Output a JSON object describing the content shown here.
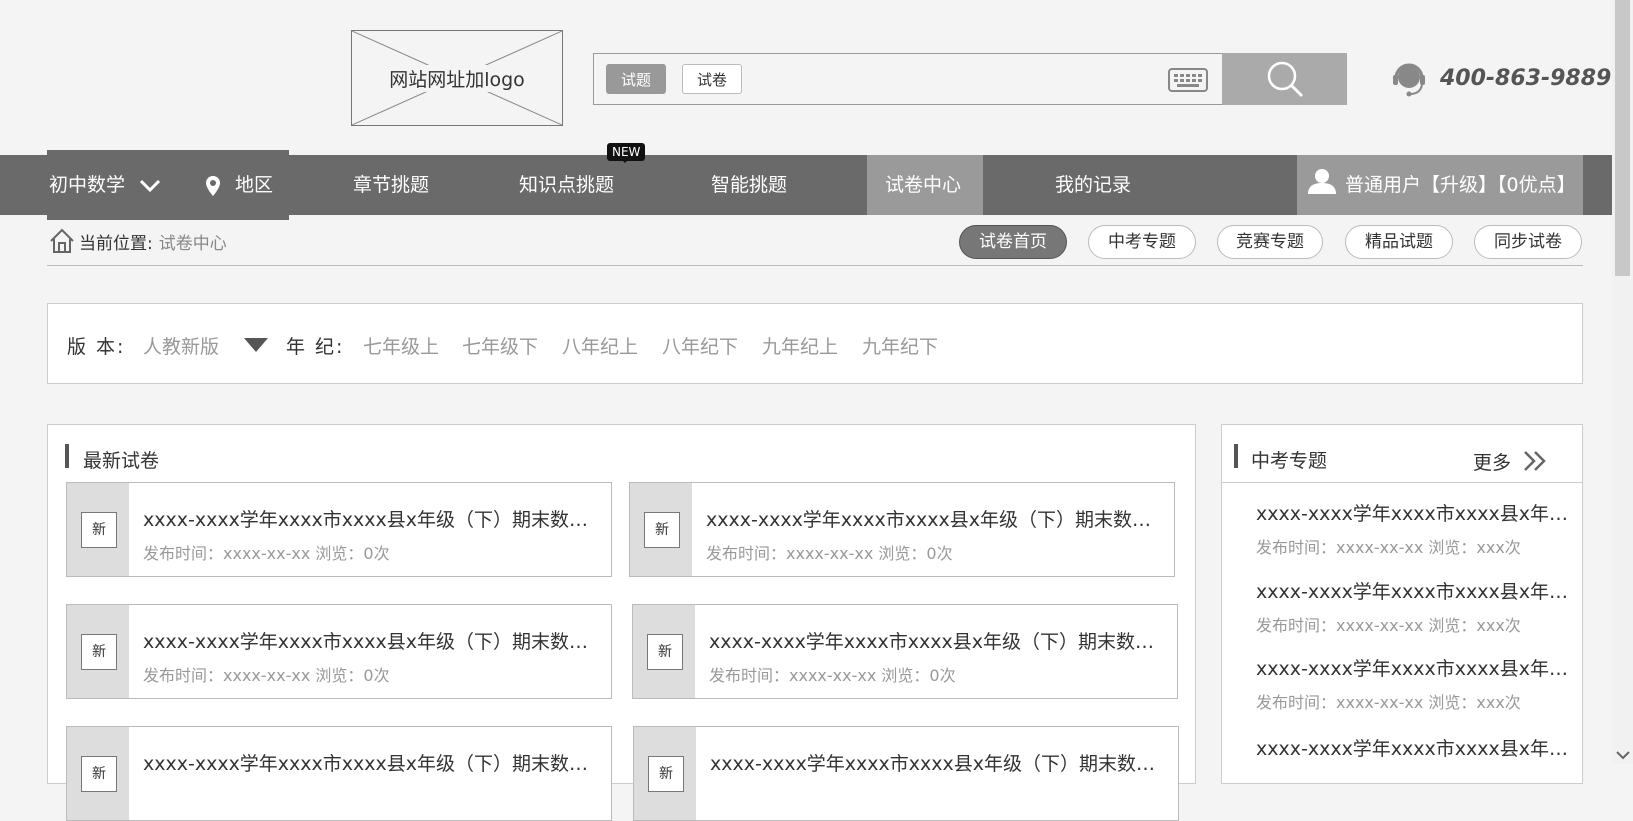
{
  "header": {
    "logo_text": "网站网址加logo",
    "search": {
      "tabs": [
        "试题",
        "试卷"
      ],
      "placeholder": ""
    },
    "hotline": "400-863-9889"
  },
  "nav": {
    "subject": "初中数学",
    "region": "地区",
    "items": [
      "章节挑题",
      "知识点挑题",
      "智能挑题",
      "试卷中心",
      "我的记录"
    ],
    "new_badge": "NEW",
    "active": "试卷中心",
    "user": "普通用户【升级】【0优点】"
  },
  "breadcrumb": {
    "label": "当前位置:",
    "current": "试卷中心"
  },
  "subnav": [
    "试卷首页",
    "中考专题",
    "竞赛专题",
    "精品试题",
    "同步试卷"
  ],
  "filter": {
    "edition_label": "版 本:",
    "edition_value": "人教新版",
    "grade_label": "年 纪:",
    "grades": [
      "七年级上",
      "七年级下",
      "八年纪上",
      "八年纪下",
      "九年纪上",
      "九年纪下"
    ]
  },
  "latest": {
    "title": "最新试卷",
    "badge": "新",
    "cards": [
      {
        "title": "xxxx-xxxx学年xxxx市xxxx县x年级（下）期末数学试卷",
        "meta": "发布时间：xxxx-xx-xx   浏览：0次"
      },
      {
        "title": "xxxx-xxxx学年xxxx市xxxx县x年级（下）期末数学试卷",
        "meta": "发布时间：xxxx-xx-xx   浏览：0次"
      },
      {
        "title": "xxxx-xxxx学年xxxx市xxxx县x年级（下）期末数学试卷",
        "meta": "发布时间：xxxx-xx-xx   浏览：0次"
      },
      {
        "title": "xxxx-xxxx学年xxxx市xxxx县x年级（下）期末数学试卷",
        "meta": "发布时间：xxxx-xx-xx   浏览：0次"
      },
      {
        "title": "xxxx-xxxx学年xxxx市xxxx县x年级（下）期末数学试卷",
        "meta": ""
      },
      {
        "title": "xxxx-xxxx学年xxxx市xxxx县x年级（下）期末数学试卷",
        "meta": ""
      }
    ]
  },
  "side": {
    "title": "中考专题",
    "more": "更多",
    "items": [
      {
        "title": "xxxx-xxxx学年xxxx市xxxx县x年级（下）期末数学试卷",
        "meta": "发布时间：xxxx-xx-xx   浏览：xxx次"
      },
      {
        "title": "xxxx-xxxx学年xxxx市xxxx县x年级（下）期末数学试卷",
        "meta": "发布时间：xxxx-xx-xx   浏览：xxx次"
      },
      {
        "title": "xxxx-xxxx学年xxxx市xxxx县x年级（下）期末数学试卷",
        "meta": "发布时间：xxxx-xx-xx   浏览：xxx次"
      },
      {
        "title": "xxxx-xxxx学年xxxx市xxxx县x年级（下）期末数学试卷",
        "meta": ""
      }
    ]
  }
}
